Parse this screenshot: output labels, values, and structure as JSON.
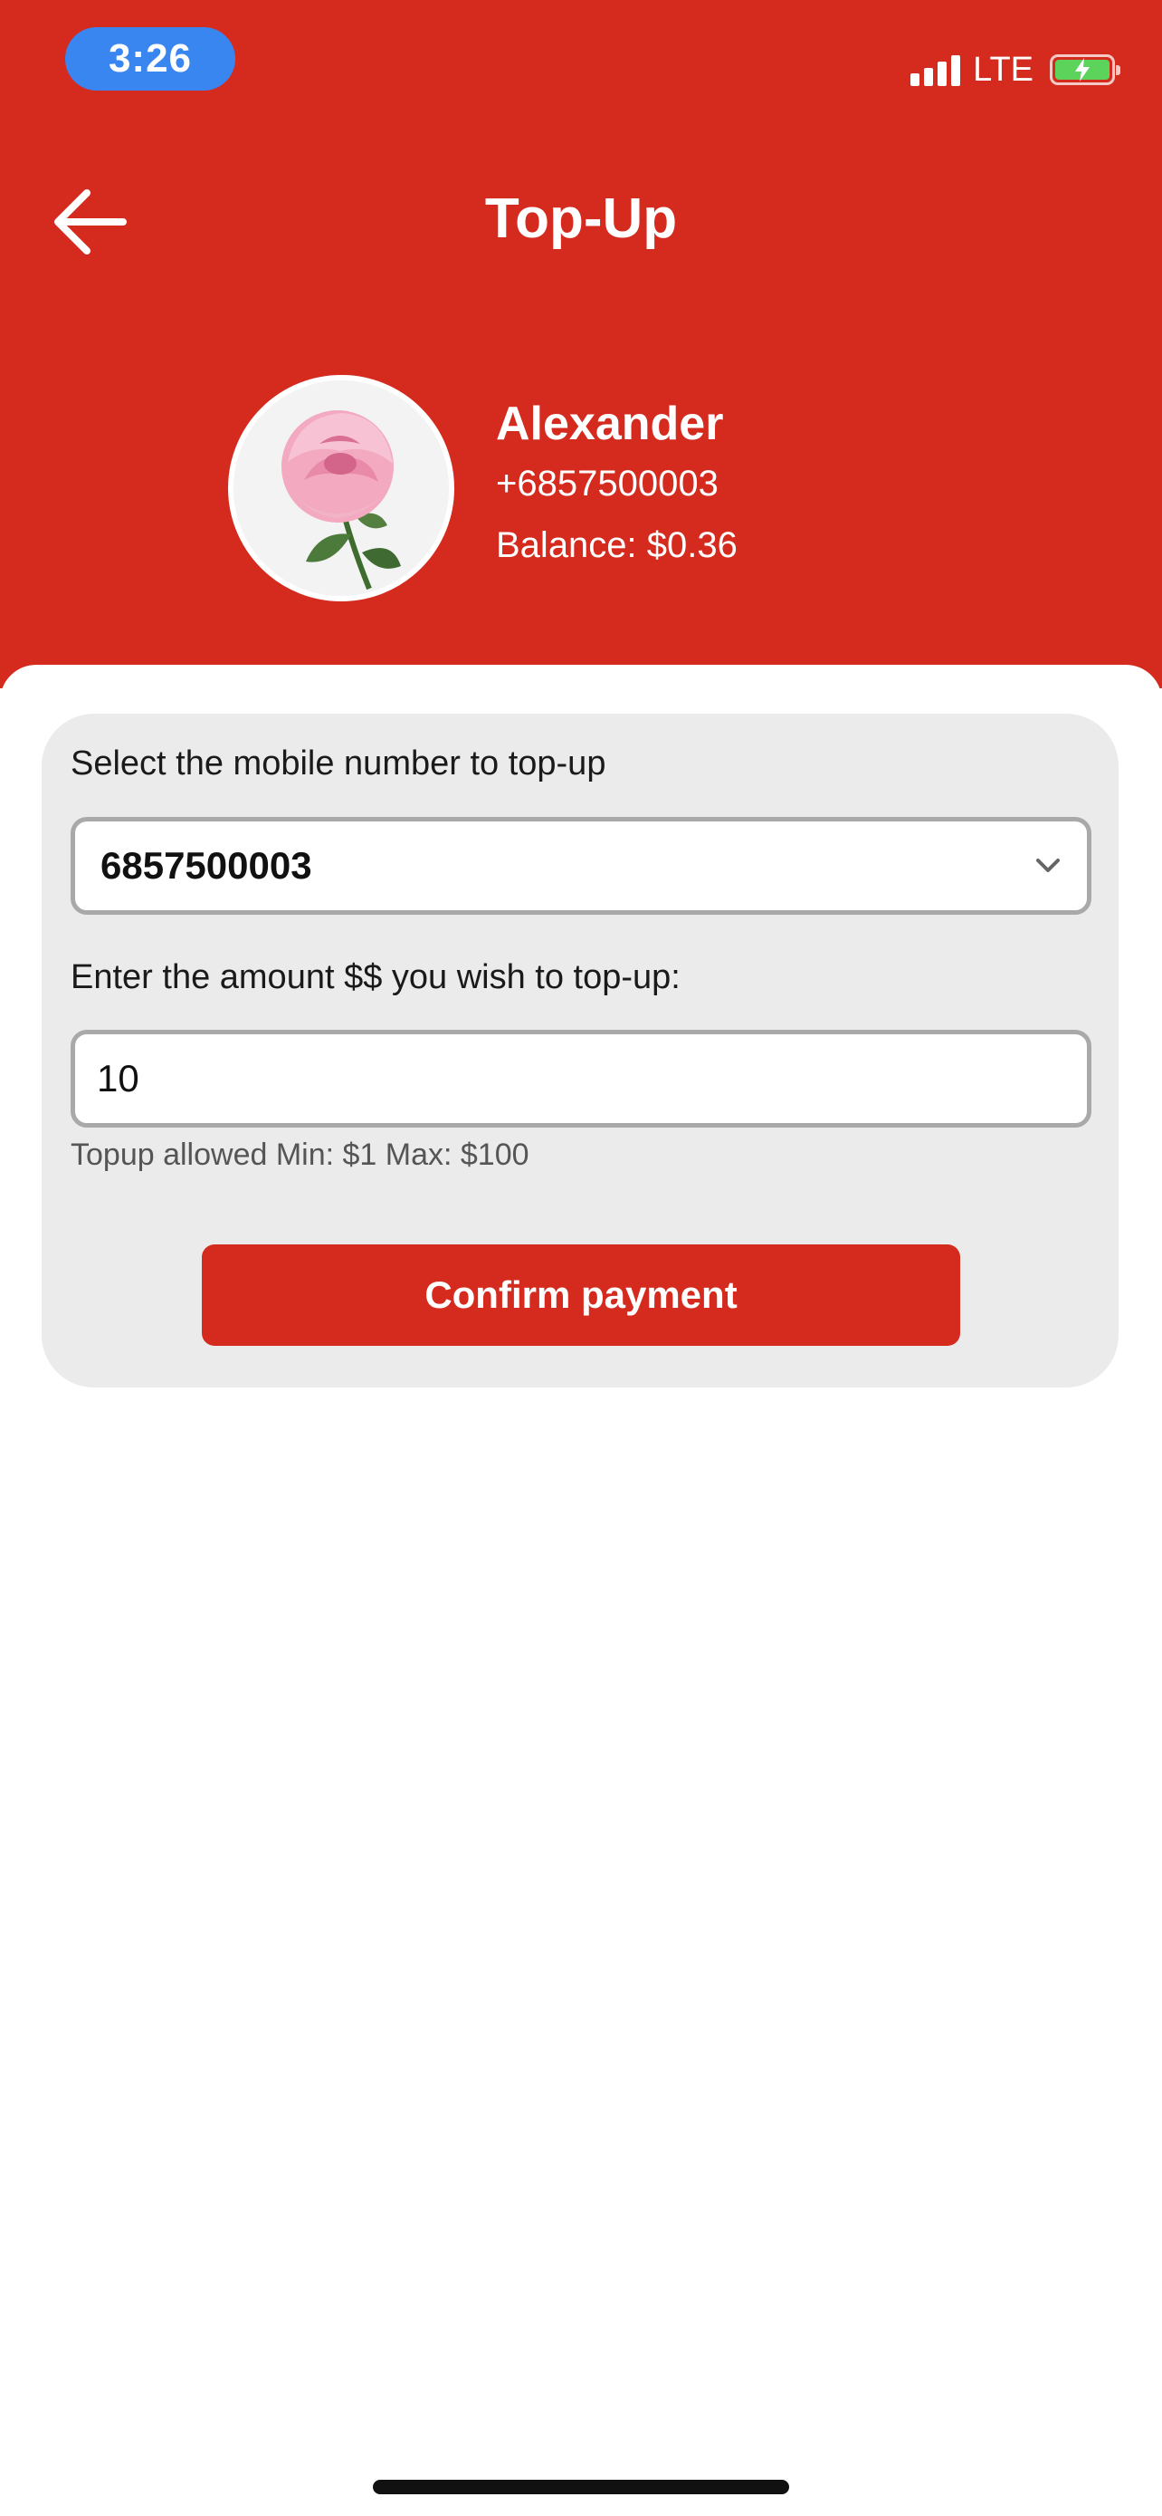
{
  "status_bar": {
    "time": "3:26",
    "network": "LTE",
    "colors": {
      "time_pill": "#3a86f0",
      "battery": "#5cd35a"
    }
  },
  "header": {
    "title": "Top-Up",
    "back_icon": "arrow-left-icon",
    "background": "#d52b1e"
  },
  "profile": {
    "name": "Alexander",
    "phone": "+6857500003",
    "balance": "Balance: $0.36",
    "avatar_icon": "rose-avatar"
  },
  "form": {
    "select_label": "Select the mobile number to top-up",
    "selected_number": "6857500003",
    "amount_label": "Enter the amount $$ you wish to top-up:",
    "amount_value": "10",
    "hint": "Topup allowed Min: $1 Max: $100",
    "confirm_label": "Confirm payment",
    "chevron_icon": "chevron-down-icon"
  }
}
